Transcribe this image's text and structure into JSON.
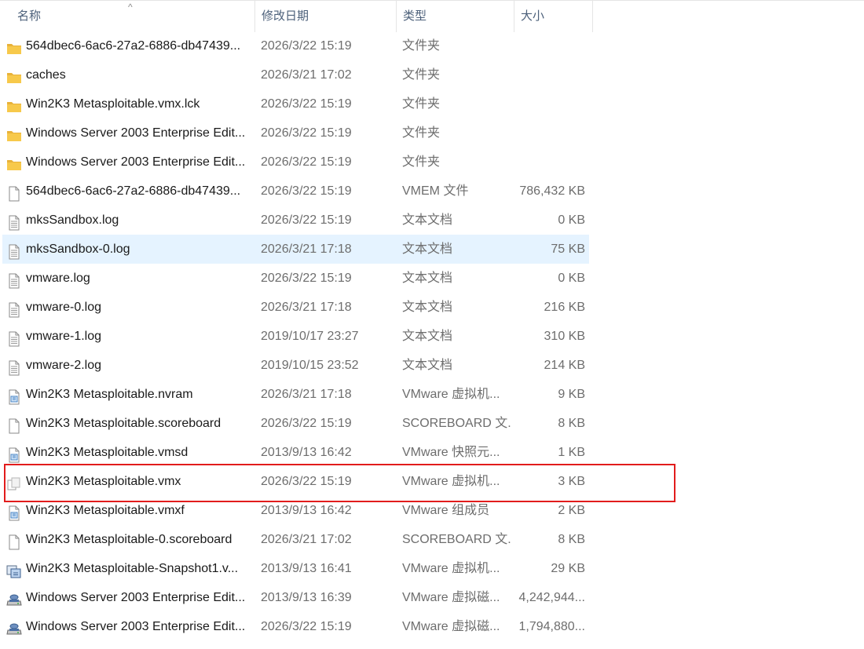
{
  "columns": {
    "name": "名称",
    "date": "修改日期",
    "type": "类型",
    "size": "大小"
  },
  "sort_indicator": "^",
  "rows": [
    {
      "icon": "folder-icon",
      "name": "564dbec6-6ac6-27a2-6886-db47439...",
      "date": "2026/3/22 15:19",
      "type": "文件夹",
      "size": ""
    },
    {
      "icon": "folder-icon",
      "name": "caches",
      "date": "2026/3/21 17:02",
      "type": "文件夹",
      "size": ""
    },
    {
      "icon": "folder-icon",
      "name": "Win2K3 Metasploitable.vmx.lck",
      "date": "2026/3/22 15:19",
      "type": "文件夹",
      "size": ""
    },
    {
      "icon": "folder-icon",
      "name": "Windows Server 2003 Enterprise Edit...",
      "date": "2026/3/22 15:19",
      "type": "文件夹",
      "size": ""
    },
    {
      "icon": "folder-icon",
      "name": "Windows Server 2003 Enterprise Edit...",
      "date": "2026/3/22 15:19",
      "type": "文件夹",
      "size": ""
    },
    {
      "icon": "file-icon",
      "name": "564dbec6-6ac6-27a2-6886-db47439...",
      "date": "2026/3/22 15:19",
      "type": "VMEM 文件",
      "size": "786,432 KB"
    },
    {
      "icon": "text-file-icon",
      "name": "mksSandbox.log",
      "date": "2026/3/22 15:19",
      "type": "文本文档",
      "size": "0 KB"
    },
    {
      "icon": "text-file-icon",
      "name": "mksSandbox-0.log",
      "date": "2026/3/21 17:18",
      "type": "文本文档",
      "size": "75 KB",
      "selected": true
    },
    {
      "icon": "text-file-icon",
      "name": "vmware.log",
      "date": "2026/3/22 15:19",
      "type": "文本文档",
      "size": "0 KB"
    },
    {
      "icon": "text-file-icon",
      "name": "vmware-0.log",
      "date": "2026/3/21 17:18",
      "type": "文本文档",
      "size": "216 KB"
    },
    {
      "icon": "text-file-icon",
      "name": "vmware-1.log",
      "date": "2019/10/17 23:27",
      "type": "文本文档",
      "size": "310 KB"
    },
    {
      "icon": "text-file-icon",
      "name": "vmware-2.log",
      "date": "2019/10/15 23:52",
      "type": "文本文档",
      "size": "214 KB"
    },
    {
      "icon": "vmware-file-icon",
      "name": "Win2K3 Metasploitable.nvram",
      "date": "2026/3/21 17:18",
      "type": "VMware 虚拟机...",
      "size": "9 KB"
    },
    {
      "icon": "file-icon",
      "name": "Win2K3 Metasploitable.scoreboard",
      "date": "2026/3/22 15:19",
      "type": "SCOREBOARD 文...",
      "size": "8 KB"
    },
    {
      "icon": "vmware-file-icon",
      "name": "Win2K3 Metasploitable.vmsd",
      "date": "2013/9/13 16:42",
      "type": "VMware 快照元...",
      "size": "1 KB"
    },
    {
      "icon": "vmx-file-icon",
      "name": "Win2K3 Metasploitable.vmx",
      "date": "2026/3/22 15:19",
      "type": "VMware 虚拟机...",
      "size": "3 KB"
    },
    {
      "icon": "vmware-file-icon",
      "name": "Win2K3 Metasploitable.vmxf",
      "date": "2013/9/13 16:42",
      "type": "VMware 组成员",
      "size": "2 KB"
    },
    {
      "icon": "file-icon",
      "name": "Win2K3 Metasploitable-0.scoreboard",
      "date": "2026/3/21 17:02",
      "type": "SCOREBOARD 文...",
      "size": "8 KB"
    },
    {
      "icon": "snapshot-file-icon",
      "name": "Win2K3 Metasploitable-Snapshot1.v...",
      "date": "2013/9/13 16:41",
      "type": "VMware 虚拟机...",
      "size": "29 KB"
    },
    {
      "icon": "disk-file-icon",
      "name": "Windows Server 2003 Enterprise Edit...",
      "date": "2013/9/13 16:39",
      "type": "VMware 虚拟磁...",
      "size": "4,242,944..."
    },
    {
      "icon": "disk-file-icon",
      "name": "Windows Server 2003 Enterprise Edit...",
      "date": "2026/3/22 15:19",
      "type": "VMware 虚拟磁...",
      "size": "1,794,880..."
    }
  ],
  "highlight_row_index": 15,
  "colors": {
    "selection": "#e5f3ff",
    "highlight_border": "#e21c1c",
    "folder": "#f7c94b",
    "header_text": "#4c607a"
  }
}
